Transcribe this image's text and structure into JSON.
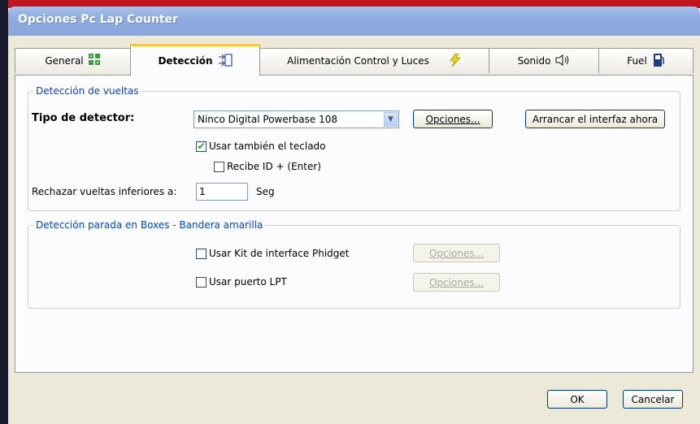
{
  "window": {
    "title": "Opciones Pc Lap Counter"
  },
  "tabs": [
    {
      "label": "General",
      "icon": "grid-icon"
    },
    {
      "label": "Detección",
      "icon": "detection-icon",
      "active": true
    },
    {
      "label": "Alimentación Control y Luces",
      "icon": "lightning-icon"
    },
    {
      "label": "Sonido",
      "icon": "speaker-icon"
    },
    {
      "label": "Fuel",
      "icon": "fuel-icon"
    }
  ],
  "lap_detection": {
    "legend": "Detección de vueltas",
    "detector_type_label": "Tipo de detector:",
    "detector_selected": "Ninco Digital Powerbase 108",
    "options_button": "Opciones...",
    "start_interface_button": "Arrancar el interfaz ahora",
    "use_keyboard_label": "Usar también el teclado",
    "use_keyboard_checked": true,
    "receive_id_label": "Recibe ID + (Enter)",
    "receive_id_checked": false,
    "reject_laps_label": "Rechazar vueltas inferiores a:",
    "reject_laps_value": "1",
    "reject_laps_unit": "Seg"
  },
  "pit_detection": {
    "legend": "Detección parada en Boxes - Bandera amarilla",
    "phidget_label": "Usar Kit de interface Phidget",
    "phidget_checked": false,
    "phidget_options_button": "Opciones...",
    "lpt_label": "Usar puerto LPT",
    "lpt_checked": false,
    "lpt_options_button": "Opciones..."
  },
  "footer": {
    "ok_button": "OK",
    "cancel_button": "Cancelar"
  },
  "colors": {
    "accent_legend": "#0046d5",
    "active_tab_highlight": "#ffc83c",
    "title_bar": "#8eacdf",
    "lightning": "#e8d800"
  }
}
